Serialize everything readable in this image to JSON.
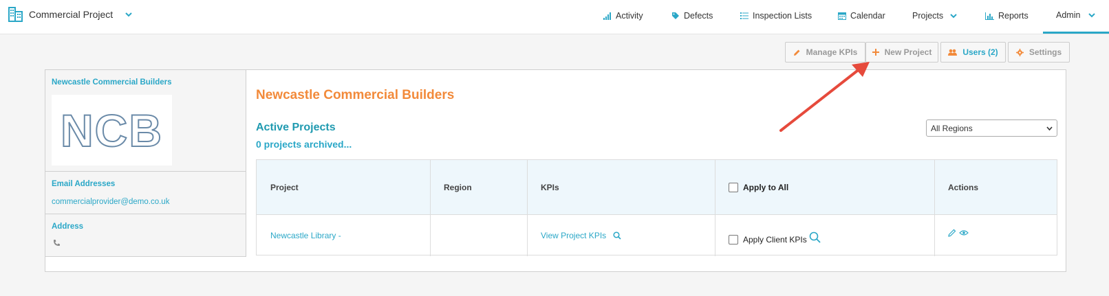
{
  "header": {
    "project_name": "Commercial Project",
    "nav": [
      {
        "label": "Activity",
        "icon": "activity-bars-icon"
      },
      {
        "label": "Defects",
        "icon": "tag-icon"
      },
      {
        "label": "Inspection Lists",
        "icon": "list-icon"
      },
      {
        "label": "Calendar",
        "icon": "calendar-icon"
      },
      {
        "label": "Projects",
        "icon": "chevron-down-icon"
      },
      {
        "label": "Reports",
        "icon": "bar-chart-icon"
      },
      {
        "label": "Admin",
        "icon": "chevron-down-icon"
      }
    ],
    "active_item": "Admin"
  },
  "toolbar": {
    "manage_kpis": "Manage KPIs",
    "new_project": "New Project",
    "users": "Users (2)",
    "settings": "Settings"
  },
  "sidebar": {
    "company_name": "Newcastle Commercial Builders",
    "logo_text": "NCB",
    "email_label": "Email Addresses",
    "email": "commercialprovider@demo.co.uk",
    "address_label": "Address"
  },
  "main": {
    "company_title": "Newcastle Commercial Builders",
    "active_projects": "Active Projects",
    "archived": "0 projects archived...",
    "region_filter": "All Regions"
  },
  "table": {
    "headers": [
      "Project",
      "Region",
      "KPIs",
      "Apply to All",
      "Actions"
    ],
    "rows": [
      {
        "project": "Newcastle Library -",
        "region": "",
        "kpis": "View Project KPIs",
        "apply": "Apply Client KPIs"
      }
    ]
  },
  "colors": {
    "accent": "#2aa7c7",
    "orange": "#f28a3a",
    "arrow": "#e64a3c"
  }
}
